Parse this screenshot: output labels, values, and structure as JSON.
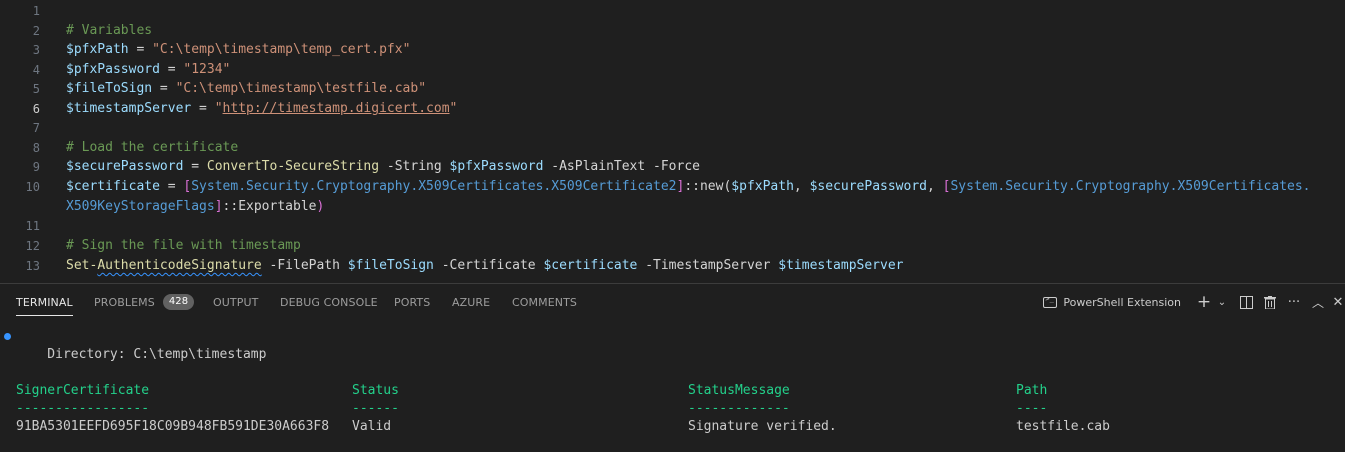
{
  "editor": {
    "line_numbers": [
      "1",
      "2",
      "3",
      "4",
      "5",
      "6",
      "7",
      "8",
      "9",
      "10",
      "11",
      "12",
      "13"
    ],
    "l2_comment": "# Variables",
    "l3": {
      "var": "$pfxPath",
      "op": " = ",
      "str": "\"C:\\temp\\timestamp\\temp_cert.pfx\""
    },
    "l4": {
      "var": "$pfxPassword",
      "op": " = ",
      "str": "\"1234\""
    },
    "l5": {
      "var": "$fileToSign",
      "op": " = ",
      "str": "\"C:\\temp\\timestamp\\testfile.cab\""
    },
    "l6": {
      "var": "$timestampServer",
      "op": " = ",
      "q1": "\"",
      "url": "http://timestamp.digicert.com",
      "q2": "\""
    },
    "l8_comment": "# Load the certificate",
    "l9": {
      "var": "$securePassword",
      "op": " = ",
      "fn": "ConvertTo-SecureString",
      "p1": " -String ",
      "v1": "$pfxPassword",
      "p2": " -AsPlainText -Force"
    },
    "l10": {
      "var": "$certificate",
      "op": " = ",
      "b1": "[",
      "type1": "System.Security.Cryptography.X509Certificates.X509Certificate2",
      "b2": "]",
      "call": "::new(",
      "v1": "$pfxPath",
      "sep1": ", ",
      "v2": "$securePassword",
      "sep2": ", ",
      "b3": "[",
      "type2": "System.Security.Cryptography.X509Certificates.",
      "type2b": "X509KeyStorageFlags",
      "b4": "]",
      "tail": "::Exportable",
      "close": ")"
    },
    "l12_comment": "# Sign the file with timestamp",
    "l13": {
      "fn1": "Set-",
      "fn2": "AuthenticodeSignature",
      "p1": " -FilePath ",
      "v1": "$fileToSign",
      "p2": " -Certificate ",
      "v2": "$certificate",
      "p3": " -TimestampServer ",
      "v3": "$timestampServer"
    }
  },
  "panel": {
    "tabs": [
      "TERMINAL",
      "PROBLEMS",
      "OUTPUT",
      "DEBUG CONSOLE",
      "PORTS",
      "AZURE",
      "COMMENTS"
    ],
    "problems_count": "428",
    "active_tab": "TERMINAL",
    "powershell_label": "PowerShell Extension",
    "icons": [
      "terminal-icon",
      "plus-icon",
      "chevron-down-icon",
      "split-icon",
      "trash-icon",
      "more-icon",
      "chevron-up-icon",
      "close-icon"
    ]
  },
  "terminal": {
    "directory_line": "    Directory: C:\\temp\\timestamp",
    "headers": [
      "SignerCertificate",
      "Status",
      "StatusMessage",
      "Path"
    ],
    "dashes": [
      "-----------------",
      "------",
      "-------------",
      "----"
    ],
    "row": [
      "91BA5301EEFD695F18C09B948FB591DE30A663F8",
      "Valid",
      "Signature verified.",
      "testfile.cab"
    ]
  },
  "colors": {
    "background": "#1f1f1f",
    "comment": "#6a9955",
    "variable": "#9cdcfe",
    "string": "#ce9178",
    "function": "#dcdcaa",
    "type": "#4ec9b0",
    "header": "#23d18b"
  }
}
